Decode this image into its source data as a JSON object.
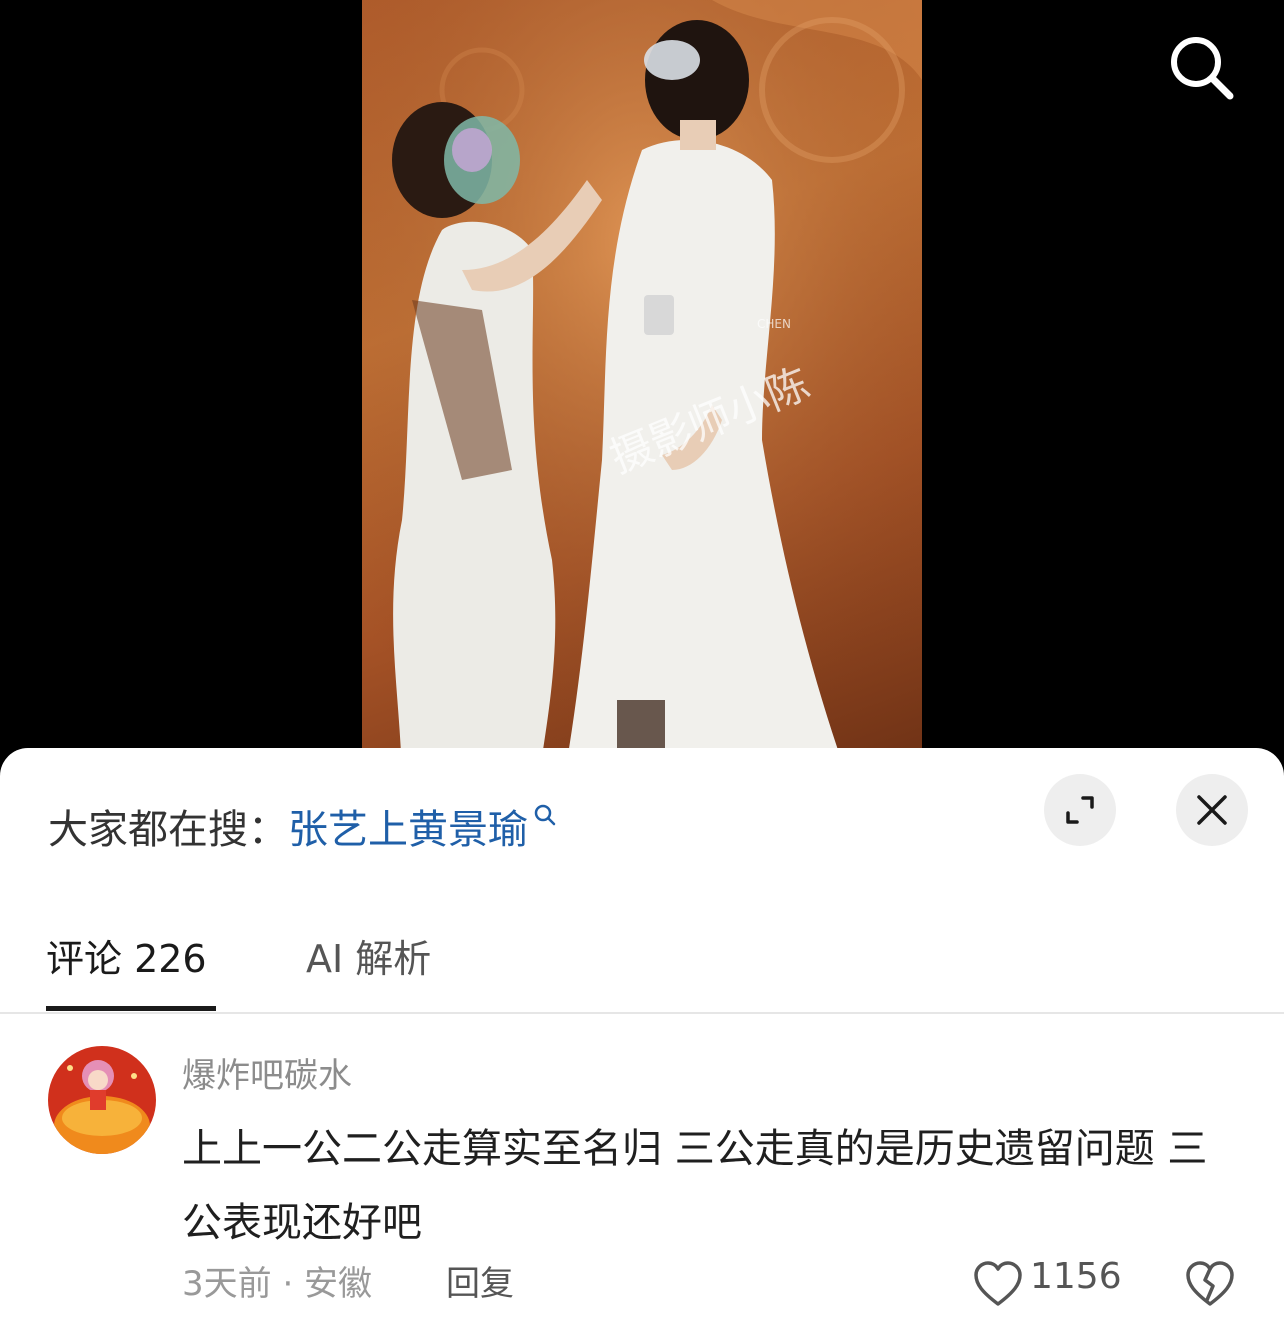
{
  "video": {
    "watermark": "摄影师小陈",
    "watermark_small": "CHEN"
  },
  "trending": {
    "prefix": "大家都在搜：",
    "query": "张艺上黄景瑜"
  },
  "tabs": [
    {
      "label": "评论 226",
      "active": true
    },
    {
      "label": "AI 解析",
      "active": false
    }
  ],
  "comments": [
    {
      "username": "爆炸吧碳水",
      "text": "上上一公二公走算实至名归 三公走真的是历史遗留问题 三公表现还好吧",
      "time": "3天前",
      "location": "安徽",
      "meta": "3天前 · 安徽",
      "reply_label": "回复",
      "likes": "1156"
    }
  ],
  "icons": {
    "search": "search-icon",
    "expand": "expand-icon",
    "close": "close-icon",
    "like": "heart-icon",
    "dislike": "broken-heart-icon"
  },
  "colors": {
    "link": "#1f5fa8",
    "sheet_bg": "#ffffff",
    "button_bg": "#eeeeee"
  }
}
